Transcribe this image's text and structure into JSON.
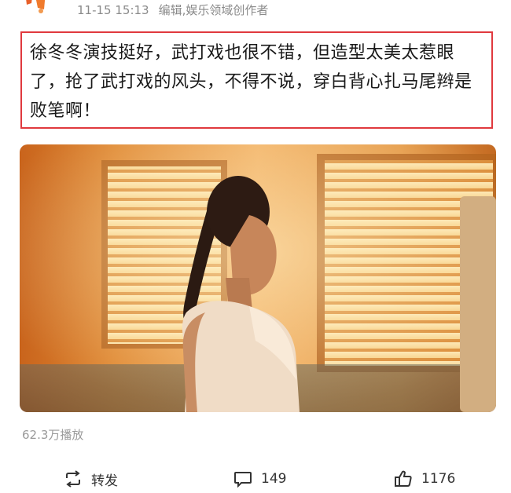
{
  "meta": {
    "timestamp": "11-15 15:13",
    "source": "编辑,娱乐领域创作者"
  },
  "post": {
    "text": "徐冬冬演技挺好，武打戏也很不错，但造型太美太惹眼了，抢了武打戏的风头，不得不说，穿白背心扎马尾辫是败笔啊！"
  },
  "video": {
    "plays": "62.3万播放"
  },
  "actions": {
    "repost_label": "转发",
    "comment_count": "149",
    "like_count": "1176"
  },
  "icons": {
    "avatar": "avatar-image",
    "repost": "repost-icon",
    "comment": "comment-icon",
    "like": "thumbs-up-icon"
  },
  "colors": {
    "highlight_border": "#e0393e",
    "meta_text": "#8a8a8a"
  }
}
